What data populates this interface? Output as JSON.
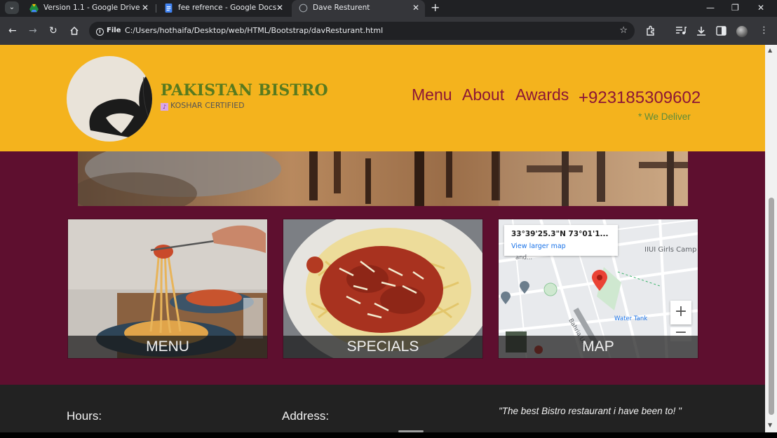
{
  "browser": {
    "tabs": [
      {
        "title": "Version 1.1 - Google Drive",
        "active": false
      },
      {
        "title": "fee refrence - Google Docs",
        "active": false
      },
      {
        "title": "Dave Resturent",
        "active": true
      }
    ],
    "new_tab": "+",
    "close": "✕",
    "window": {
      "minimize": "—",
      "restore": "❐",
      "close": "✕"
    },
    "file_chip": "File",
    "url": "C:/Users/hothaifa/Desktop/web/HTML/Bootstrap/davResturant.html"
  },
  "site": {
    "brand": "PAKISTAN BISTRO",
    "certified": "KOSHAR CERTIFIED",
    "nav": [
      "Menu",
      "About",
      "Awards"
    ],
    "phone": "+923185309602",
    "deliver": "* We Deliver",
    "cards": [
      {
        "caption": "MENU"
      },
      {
        "caption": "SPECIALS"
      },
      {
        "caption": "MAP"
      }
    ],
    "map": {
      "coords": "33°39'25.3\"N 73°01'1...",
      "larger": "View larger map",
      "labels": [
        "IIUI Girls Camp",
        "and...",
        "Water Tank",
        "Bahria Univ"
      ],
      "zoom_in": "+",
      "zoom_out": "−"
    },
    "footer": {
      "hours": "Hours:",
      "address": "Address:",
      "quote": "\"The best Bistro restaurant i have been to! \""
    }
  },
  "colors": {
    "header_bg": "#f4b31d",
    "body_bg": "#5e0f2f",
    "nav_text": "#8c1636",
    "brand_text": "#587a1e",
    "footer_bg": "#222222"
  }
}
